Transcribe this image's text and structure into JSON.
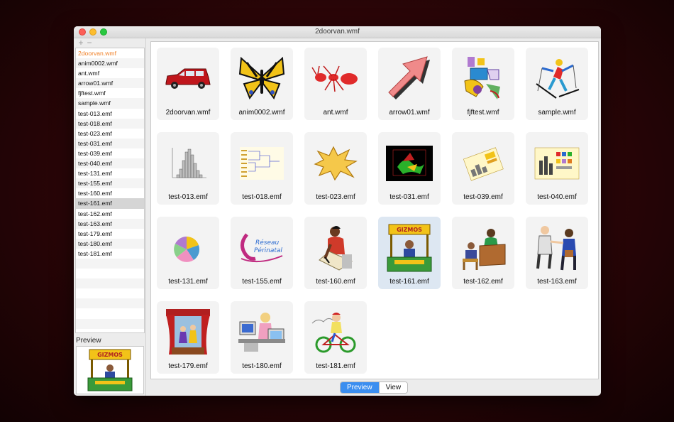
{
  "window": {
    "title": "2doorvan.wmf"
  },
  "sidebar": {
    "add_glyph": "+",
    "remove_glyph": "−",
    "files": [
      {
        "name": "2doorvan.wmf",
        "state": "active"
      },
      {
        "name": "anim0002.wmf"
      },
      {
        "name": "ant.wmf"
      },
      {
        "name": "arrow01.wmf"
      },
      {
        "name": "fjftest.wmf"
      },
      {
        "name": "sample.wmf"
      },
      {
        "name": "test-013.emf"
      },
      {
        "name": "test-018.emf"
      },
      {
        "name": "test-023.emf"
      },
      {
        "name": "test-031.emf"
      },
      {
        "name": "test-039.emf"
      },
      {
        "name": "test-040.emf"
      },
      {
        "name": "test-131.emf"
      },
      {
        "name": "test-155.emf"
      },
      {
        "name": "test-160.emf"
      },
      {
        "name": "test-161.emf",
        "state": "selected"
      },
      {
        "name": "test-162.emf"
      },
      {
        "name": "test-163.emf"
      },
      {
        "name": "test-179.emf"
      },
      {
        "name": "test-180.emf"
      },
      {
        "name": "test-181.emf"
      }
    ],
    "preview_label": "Preview"
  },
  "grid": {
    "items": [
      {
        "label": "2doorvan.wmf",
        "icon": "van-icon"
      },
      {
        "label": "anim0002.wmf",
        "icon": "butterfly-icon"
      },
      {
        "label": "ant.wmf",
        "icon": "ant-icon"
      },
      {
        "label": "arrow01.wmf",
        "icon": "arrow-icon"
      },
      {
        "label": "fjftest.wmf",
        "icon": "shapes-icon"
      },
      {
        "label": "sample.wmf",
        "icon": "skier-icon"
      },
      {
        "label": "test-013.emf",
        "icon": "histogram-icon"
      },
      {
        "label": "test-018.emf",
        "icon": "dendrogram-icon"
      },
      {
        "label": "test-023.emf",
        "icon": "starburst-icon"
      },
      {
        "label": "test-031.emf",
        "icon": "3d-plot-icon"
      },
      {
        "label": "test-039.emf",
        "icon": "tilted-chart-icon"
      },
      {
        "label": "test-040.emf",
        "icon": "color-chart-icon"
      },
      {
        "label": "test-131.emf",
        "icon": "pie-chart-icon"
      },
      {
        "label": "test-155.emf",
        "icon": "reseau-logo-icon",
        "logo_text": "Réseau Périnatal"
      },
      {
        "label": "test-160.emf",
        "icon": "writing-person-icon"
      },
      {
        "label": "test-161.emf",
        "icon": "gizmos-booth-icon",
        "state": "selected"
      },
      {
        "label": "test-162.emf",
        "icon": "office-desk-icon"
      },
      {
        "label": "test-163.emf",
        "icon": "handshake-icon"
      },
      {
        "label": "test-179.emf",
        "icon": "puppet-theater-icon"
      },
      {
        "label": "test-180.emf",
        "icon": "computer-worker-icon"
      },
      {
        "label": "test-181.emf",
        "icon": "cyclist-icon"
      }
    ]
  },
  "segmented": {
    "preview_label": "Preview",
    "view_label": "View",
    "selected": "Preview"
  },
  "colors": {
    "accent": "#3b8ef0",
    "active_file": "#f07f25",
    "selected_tile": "#dde7f2"
  }
}
